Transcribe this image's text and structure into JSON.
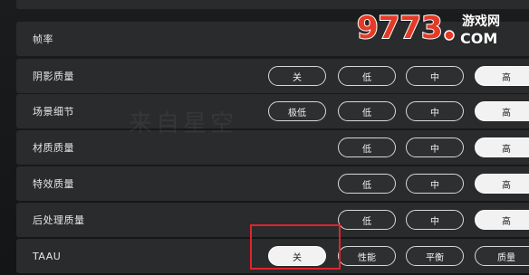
{
  "rows": [
    {
      "key": "framerate",
      "label": "帧率",
      "options": []
    },
    {
      "key": "shadow",
      "label": "阴影质量",
      "options": [
        "关",
        "低",
        "中",
        "高"
      ],
      "selected": "高"
    },
    {
      "key": "scene",
      "label": "场景细节",
      "options": [
        "极低",
        "低",
        "中",
        "高"
      ],
      "selected": "高"
    },
    {
      "key": "material",
      "label": "材质质量",
      "options": [
        "低",
        "中",
        "高"
      ],
      "selected": "高"
    },
    {
      "key": "effects",
      "label": "特效质量",
      "options": [
        "低",
        "中",
        "高"
      ],
      "selected": "高"
    },
    {
      "key": "postfx",
      "label": "后处理质量",
      "options": [
        "低",
        "中",
        "高"
      ],
      "selected": "高"
    },
    {
      "key": "taau",
      "label": "TAAU",
      "options": [
        "关",
        "性能",
        "平衡",
        "质量"
      ],
      "selected": "关"
    }
  ],
  "watermark": {
    "text": "9773",
    "suffix": "游戏网",
    "com": "COM"
  },
  "background_watermark": "来自星空",
  "colors": {
    "highlight": "#e1232f",
    "accent_selected": "#f2f2f2"
  }
}
